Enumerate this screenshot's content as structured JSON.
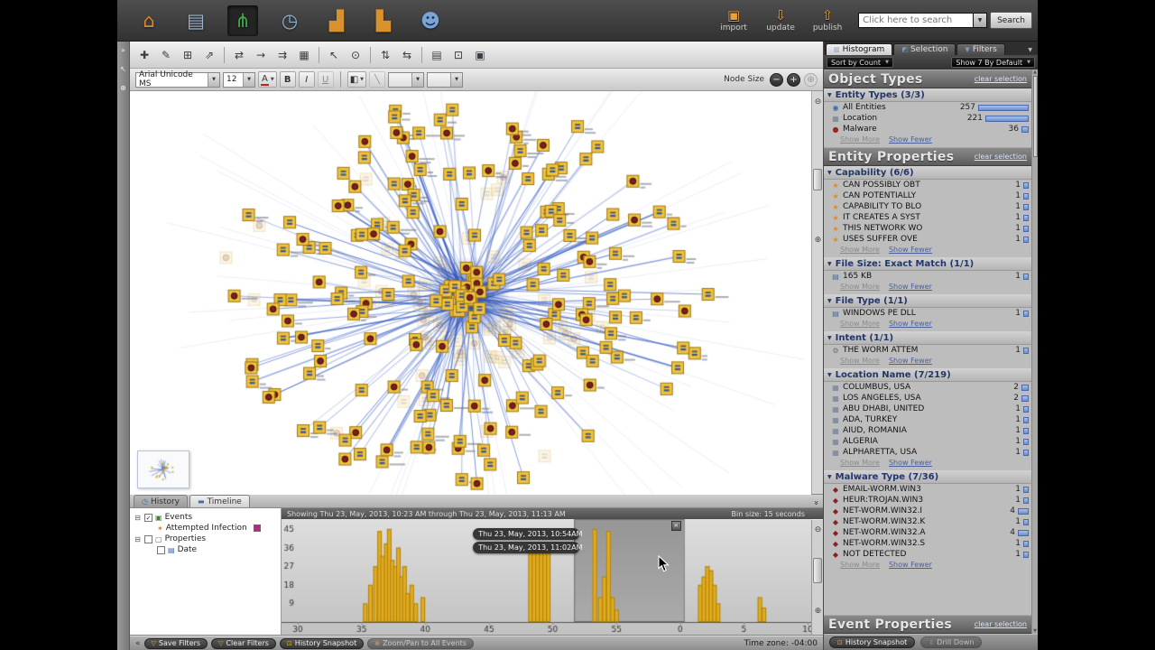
{
  "glyphs": {
    "dropdown": "▼",
    "close": "✕",
    "collapse_left": "«",
    "chevron": "»",
    "zoom_out": "⊖",
    "zoom_in": "⊕",
    "minus": "−",
    "plus": "+",
    "reset": "⊕",
    "fill": "◧",
    "slash": "╲",
    "history_tab": "◷",
    "timeline_tab": "▬",
    "up": "▲",
    "down": "▼",
    "check": "✓",
    "expander": "⊟"
  },
  "colors": {
    "accent_blue": "#2d55c0",
    "node_yellow": "#f1c23c",
    "bar_yellow": "#e3ac1e",
    "selection_magenta": "#b5298c"
  },
  "top_toolbar": {
    "nav_icons": [
      {
        "name": "home-icon",
        "glyph": "⌂",
        "color": "#e0872f",
        "active": false
      },
      {
        "name": "report-icon",
        "glyph": "▤",
        "color": "#9ab4d0",
        "active": false
      },
      {
        "name": "graph-icon",
        "glyph": "⋔",
        "color": "#3fae49",
        "active": true
      },
      {
        "name": "clock-map-icon",
        "glyph": "◷",
        "color": "#8fb3d8",
        "active": false
      },
      {
        "name": "chart-icon",
        "glyph": "▟",
        "color": "#d8912c",
        "active": false
      },
      {
        "name": "browser-chart-icon",
        "glyph": "▙",
        "color": "#d8912c",
        "active": false
      },
      {
        "name": "collaboration-icon",
        "glyph": "☻",
        "color": "#7aa3d8",
        "active": false
      }
    ],
    "actions": [
      {
        "label": "import",
        "name": "import-button",
        "icon": "import-icon",
        "glyph": "▣"
      },
      {
        "label": "update",
        "name": "update-button",
        "icon": "update-icon",
        "glyph": "⇩"
      },
      {
        "label": "publish",
        "name": "publish-button",
        "icon": "publish-icon",
        "glyph": "⇧"
      }
    ],
    "search": {
      "placeholder": "Click here to search",
      "button_label": "Search"
    }
  },
  "left_strip": {
    "icons": [
      {
        "name": "expand-panel-icon",
        "glyph": "»"
      },
      {
        "name": "pointer-tool-icon",
        "glyph": "↖"
      },
      {
        "name": "zoom-tool-icon",
        "glyph": "⊕"
      }
    ]
  },
  "graph_toolbar": {
    "buttons": [
      {
        "name": "add-entity-icon",
        "glyph": "✚"
      },
      {
        "name": "add-label-icon",
        "glyph": "✎"
      },
      {
        "name": "add-entity-from-template-icon",
        "glyph": "⊞"
      },
      {
        "name": "add-inferred-entity-icon",
        "glyph": "⇗"
      },
      {
        "sep": true
      },
      {
        "name": "add-link-icon",
        "glyph": "⇄"
      },
      {
        "name": "link-direction-icon",
        "glyph": "→"
      },
      {
        "name": "merge-entities-icon",
        "glyph": "⇉"
      },
      {
        "name": "grid-layout-icon",
        "glyph": "▦"
      },
      {
        "sep": true
      },
      {
        "name": "select-tool-icon",
        "glyph": "↖"
      },
      {
        "name": "pin-node-icon",
        "glyph": "⊙"
      },
      {
        "sep": true
      },
      {
        "name": "swap-vertical-icon",
        "glyph": "⇅"
      },
      {
        "name": "swap-horizontal-icon",
        "glyph": "⇆"
      },
      {
        "sep": true
      },
      {
        "name": "report-view-icon",
        "glyph": "▤"
      },
      {
        "name": "snapshot-camera-icon",
        "glyph": "⊡"
      },
      {
        "name": "export-image-icon",
        "glyph": "▣"
      }
    ]
  },
  "font_toolbar": {
    "font_name": "Arial Unicode MS",
    "font_size": "12",
    "color_letter": "A",
    "bold": "B",
    "italic": "I",
    "underline": "U",
    "node_size_label": "Node Size"
  },
  "graph": {
    "seed": 12,
    "nodes": 165,
    "center_nodes": 30,
    "ghost_nodes": 60,
    "malware_fraction": 0.32,
    "node_color": "#f1c23c",
    "node_border": "#9a7714",
    "edge_color": "#2d55c0"
  },
  "bottom_tabs": {
    "history": "History",
    "timeline": "Timeline"
  },
  "tree": {
    "rows": [
      {
        "indent": 0,
        "expander": true,
        "checkbox": "checked",
        "icon": "events-folder-icon",
        "glyph": "▣",
        "glyph_color": "#4a7a3a",
        "label": "Events"
      },
      {
        "indent": 1,
        "expander": false,
        "checkbox": null,
        "icon": "attempted-infection-icon",
        "glyph": "✶",
        "glyph_color": "#d07818",
        "label": "Attempted Infection",
        "swatch": "#b5298c"
      },
      {
        "indent": 0,
        "expander": true,
        "checkbox": "unchecked",
        "icon": "properties-folder-icon",
        "glyph": "▢",
        "glyph_color": "#666666",
        "label": "Properties"
      },
      {
        "indent": 1,
        "expander": false,
        "checkbox": "unchecked",
        "icon": "date-property-icon",
        "glyph": "▤",
        "glyph_color": "#3a5fa0",
        "label": "Date"
      }
    ]
  },
  "timeline": {
    "header_left": "Showing Thu 23, May, 2013, 10:23 AM through Thu 23, May, 2013, 11:13 AM",
    "header_right": "Bin size: 15 seconds",
    "tooltip": [
      "Thu 23, May, 2013, 10:54AM",
      "Thu 23, May, 2013, 11:02AM"
    ],
    "chart_data": {
      "type": "bar",
      "title": "Event count over time",
      "x_ticks": [
        "30",
        "35",
        "40",
        "45",
        "50",
        "55",
        "0",
        "5",
        "10"
      ],
      "y_ticks": [
        9,
        18,
        27,
        36,
        45
      ],
      "ylim": [
        0,
        48
      ],
      "bar_color": "#e3ac1e",
      "selection": {
        "from": 0.542,
        "to": 0.757
      },
      "bars": [
        [
          0.128,
          9
        ],
        [
          0.138,
          18
        ],
        [
          0.148,
          27
        ],
        [
          0.156,
          44
        ],
        [
          0.162,
          32
        ],
        [
          0.169,
          38
        ],
        [
          0.175,
          45
        ],
        [
          0.181,
          30
        ],
        [
          0.187,
          27
        ],
        [
          0.193,
          36
        ],
        [
          0.199,
          22
        ],
        [
          0.205,
          27
        ],
        [
          0.211,
          14
        ],
        [
          0.219,
          18
        ],
        [
          0.227,
          9
        ],
        [
          0.241,
          12
        ],
        [
          0.452,
          36
        ],
        [
          0.459,
          36
        ],
        [
          0.466,
          36
        ],
        [
          0.473,
          36
        ],
        [
          0.48,
          36
        ],
        [
          0.487,
          36
        ],
        [
          0.578,
          45
        ],
        [
          0.589,
          12
        ],
        [
          0.597,
          22
        ],
        [
          0.605,
          44
        ],
        [
          0.613,
          12
        ],
        [
          0.621,
          6
        ],
        [
          0.785,
          18
        ],
        [
          0.792,
          22
        ],
        [
          0.799,
          27
        ],
        [
          0.806,
          25
        ],
        [
          0.813,
          18
        ],
        [
          0.82,
          9
        ],
        [
          0.902,
          12
        ],
        [
          0.91,
          7
        ]
      ]
    }
  },
  "status_bar": {
    "buttons": [
      {
        "label": "Save Filters",
        "icon": "filter-icon",
        "glyph": "▽"
      },
      {
        "label": "Clear Filters",
        "icon": "filter-clear-icon",
        "glyph": "▽"
      },
      {
        "label": "History Snapshot",
        "icon": "camera-icon",
        "glyph": "⊡"
      },
      {
        "label": "Zoom/Pan to All Events",
        "icon": "zoom-events-icon",
        "glyph": "⊕",
        "disabled": true
      }
    ],
    "timezone": "Time zone: -04:00"
  },
  "histogram_panel": {
    "tabs": [
      {
        "label": "Histogram",
        "icon": "histogram-tab-icon",
        "glyph": "▥",
        "active": true
      },
      {
        "label": "Selection",
        "icon": "selection-tab-icon",
        "glyph": "◩",
        "active": false
      },
      {
        "label": "Filters",
        "icon": "filters-tab-icon",
        "glyph": "▼",
        "active": false
      }
    ],
    "sort_dropdown": "Sort by Count",
    "show_dropdown": "Show 7 By Default",
    "groups": [
      {
        "title": "Object Types",
        "clear_label": "clear selection",
        "sections": [
          {
            "title": "Entity Types (3/3)",
            "items": [
              {
                "icon": "entities-icon",
                "glyph": "◉",
                "label": "All Entities",
                "count": 257,
                "bar": 1.0
              },
              {
                "icon": "location-icon",
                "glyph": "▦",
                "label": "Location",
                "count": 221,
                "bar": 0.86
              },
              {
                "icon": "malware-icon",
                "glyph": "●",
                "label": "Malware",
                "count": 36,
                "bar": 0.14
              }
            ],
            "links": [
              "Show More",
              "Show Fewer"
            ]
          }
        ]
      },
      {
        "title": "Entity Properties",
        "clear_label": "clear selection",
        "sections": [
          {
            "title": "Capability (6/6)",
            "items": [
              {
                "icon": "star-icon",
                "glyph": "★",
                "label": "CAN POSSIBLY OBT",
                "count": 1
              },
              {
                "icon": "star-icon",
                "glyph": "★",
                "label": "CAN POTENTIALLY",
                "count": 1
              },
              {
                "icon": "star-icon",
                "glyph": "★",
                "label": "CAPABILITY TO BLO",
                "count": 1
              },
              {
                "icon": "star-icon",
                "glyph": "★",
                "label": "IT CREATES A SYST",
                "count": 1
              },
              {
                "icon": "star-icon",
                "glyph": "★",
                "label": "THIS NETWORK WO",
                "count": 1
              },
              {
                "icon": "star-icon",
                "glyph": "★",
                "label": "USES SUFFER OVE",
                "count": 1
              }
            ],
            "links": [
              "Show More",
              "Show Fewer"
            ]
          },
          {
            "title": "File Size: Exact Match (1/1)",
            "items": [
              {
                "icon": "file-icon",
                "glyph": "▤",
                "label": "165 KB",
                "count": 1
              }
            ],
            "links": [
              "Show More",
              "Show Fewer"
            ]
          },
          {
            "title": "File Type (1/1)",
            "items": [
              {
                "icon": "file-icon",
                "glyph": "▤",
                "label": "WINDOWS PE DLL",
                "count": 1
              }
            ],
            "links": [
              "Show More",
              "Show Fewer"
            ]
          },
          {
            "title": "Intent (1/1)",
            "items": [
              {
                "icon": "gear-icon",
                "glyph": "⚙",
                "label": "THE WORM ATTEM",
                "count": 1
              }
            ],
            "links": [
              "Show More",
              "Show Fewer"
            ]
          },
          {
            "title": "Location Name (7/219)",
            "items": [
              {
                "icon": "building-icon",
                "glyph": "▦",
                "label": "COLUMBUS, USA",
                "count": 2
              },
              {
                "icon": "building-icon",
                "glyph": "▦",
                "label": "LOS ANGELES, USA",
                "count": 2
              },
              {
                "icon": "building-icon",
                "glyph": "▦",
                "label": "ABU DHABI, UNITED",
                "count": 1
              },
              {
                "icon": "building-icon",
                "glyph": "▦",
                "label": "ADA, TURKEY",
                "count": 1
              },
              {
                "icon": "building-icon",
                "glyph": "▦",
                "label": "AIUD, ROMANIA",
                "count": 1
              },
              {
                "icon": "building-icon",
                "glyph": "▦",
                "label": "ALGERIA",
                "count": 1
              },
              {
                "icon": "building-icon",
                "glyph": "▦",
                "label": "ALPHARETTA, USA",
                "count": 1
              }
            ],
            "links": [
              "Show More",
              "Show Fewer"
            ]
          },
          {
            "title": "Malware Type (7/36)",
            "items": [
              {
                "icon": "bug-icon",
                "glyph": "◆",
                "label": "EMAIL-WORM.WIN3",
                "count": 1
              },
              {
                "icon": "bug-icon",
                "glyph": "◆",
                "label": "HEUR:TROJAN.WIN3",
                "count": 1
              },
              {
                "icon": "bug-icon",
                "glyph": "◆",
                "label": "NET-WORM.WIN32.I",
                "count": 4
              },
              {
                "icon": "bug-icon",
                "glyph": "◆",
                "label": "NET-WORM.WIN32.K",
                "count": 1
              },
              {
                "icon": "bug-icon",
                "glyph": "◆",
                "label": "NET-WORM.WIN32.A",
                "count": 4
              },
              {
                "icon": "bug-icon",
                "glyph": "◆",
                "label": "NET-WORM.WIN32.S",
                "count": 1
              },
              {
                "icon": "bug-icon",
                "glyph": "◆",
                "label": "NOT DETECTED",
                "count": 1
              }
            ],
            "links": [
              "Show More",
              "Show Fewer"
            ]
          }
        ]
      },
      {
        "title": "Event Properties",
        "clear_label": "clear selection",
        "sections": []
      }
    ],
    "bottom_buttons": [
      {
        "label": "History Snapshot",
        "icon": "camera-icon",
        "glyph": "⊡",
        "disabled": false
      },
      {
        "label": "Drill Down",
        "icon": "drill-down-icon",
        "glyph": "⇩",
        "disabled": true
      }
    ]
  }
}
